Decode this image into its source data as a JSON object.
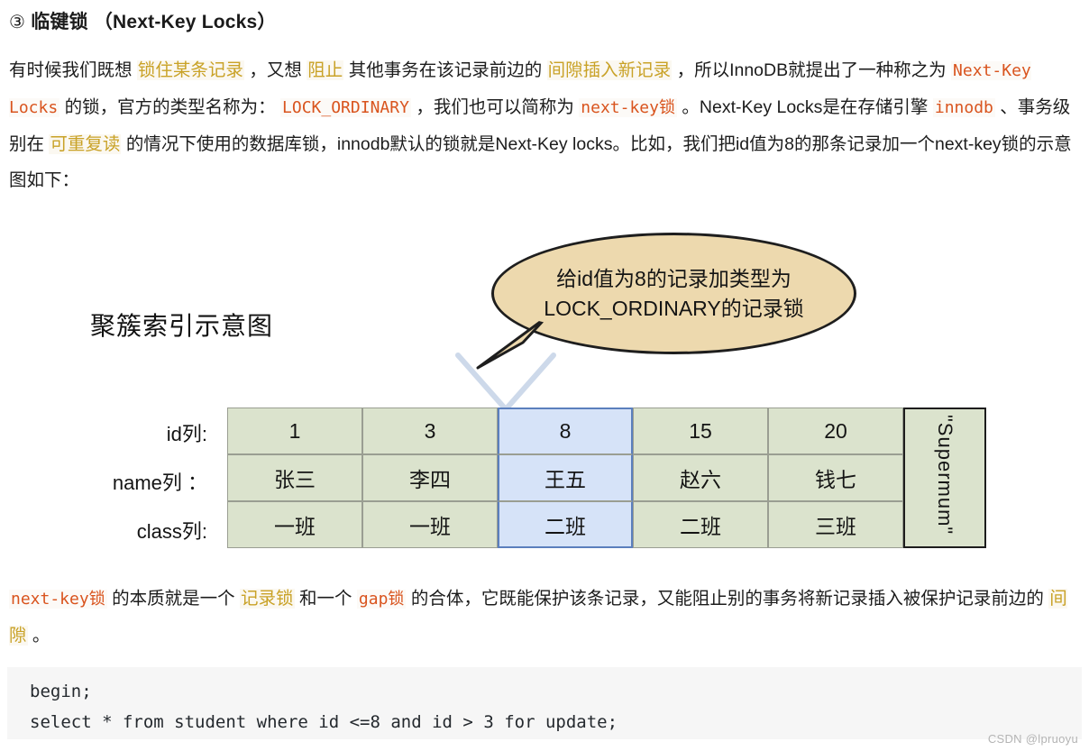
{
  "heading": {
    "marker": "③",
    "zh": "临键锁",
    "en": "（Next-Key Locks）"
  },
  "intro": {
    "p1": "有时候我们既想 ",
    "hl1": "锁住某条记录",
    "p2": " ，又想 ",
    "hl2": "阻止",
    "p3": " 其他事务在该记录前边的 ",
    "hl3": "间隙插入新记录",
    "p4": " ，所以InnoDB就提出了一种称之为 ",
    "code1": "Next-Key Locks",
    "p5": " 的锁，官方的类型名称为： ",
    "code2": "LOCK_ORDINARY",
    "p6": " ，我们也可以简称为 ",
    "code3": "next-key锁",
    "p7": " 。Next-Key Locks是在存储引擎 ",
    "code4": "innodb",
    "p8": " 、事务级别在 ",
    "hl4": "可重复读",
    "p9": " 的情况下使用的数据库锁，innodb默认的锁就是Next-Key locks。比如，我们把id值为8的那条记录加一个next-key锁的示意图如下："
  },
  "diagram": {
    "title": "聚簇索引示意图",
    "callout": "给id值为8的记录加类型为\nLOCK_ORDINARY的记录锁",
    "row_labels": [
      "id列:",
      "name列 ：",
      "class列:"
    ],
    "rows": [
      [
        "1",
        "3",
        "8",
        "15",
        "20"
      ],
      [
        "张三",
        "李四",
        "王五",
        "赵六",
        "钱七"
      ],
      [
        "一班",
        "一班",
        "二班",
        "二班",
        "三班"
      ]
    ],
    "selected_column_index": 2,
    "tail_cell": "\"Supermum\"",
    "colors": {
      "cell": "#dbe3cd",
      "cell_border": "#9a9e92",
      "selected_cell": "#d6e3f8",
      "selected_border": "#5b7fbd",
      "bubble_fill": "#edd9ae",
      "bubble_stroke": "#1e1e1e",
      "pointer": "#cdd9ea"
    }
  },
  "summary": {
    "code1": "next-key锁",
    "s1": " 的本质就是一个 ",
    "hl1": "记录锁",
    "s2": " 和一个 ",
    "code2": "gap锁",
    "s3": " 的合体，它既能保护该条记录，又能阻止别的事务将新记录插入被保护记录前边的 ",
    "hl2": "间隙",
    "s4": " 。"
  },
  "code_block": {
    "line1": "begin;",
    "line2": "select * from student where id <=8 and id > 3 for update;"
  },
  "watermark": "CSDN @lpruoyu"
}
